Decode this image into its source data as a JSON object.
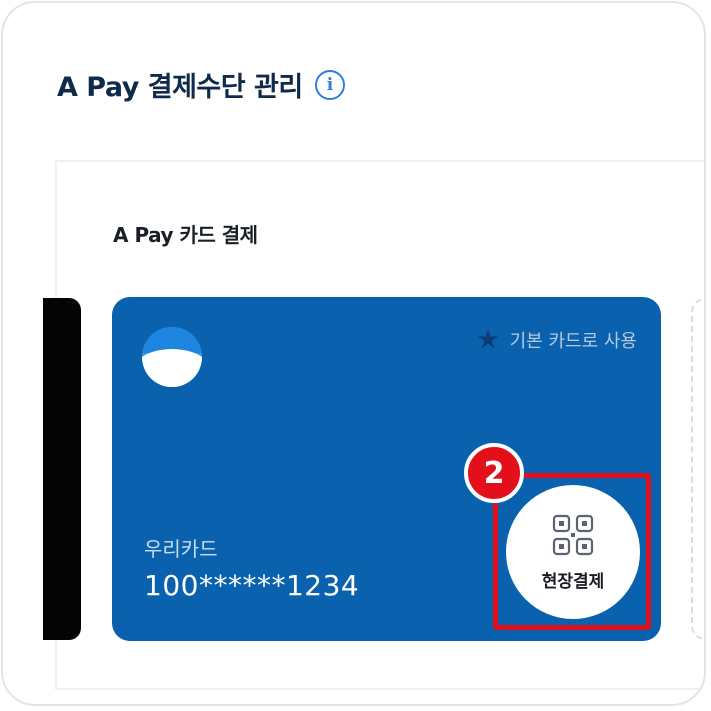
{
  "header": {
    "title": "A Pay 결제수단 관리",
    "info_icon": "info-icon"
  },
  "section": {
    "title": "A Pay 카드 결제"
  },
  "card": {
    "bank_logo": "woori-bank-logo",
    "default_label": "기본 카드로 사용",
    "default_icon": "star-icon",
    "name": "우리카드",
    "number": "100******1234",
    "onsite_pay_label": "현장결제",
    "onsite_pay_icon": "qr-code-icon",
    "color": "#0a62ae"
  },
  "annotation": {
    "step": "2",
    "color": "#e3101c"
  }
}
